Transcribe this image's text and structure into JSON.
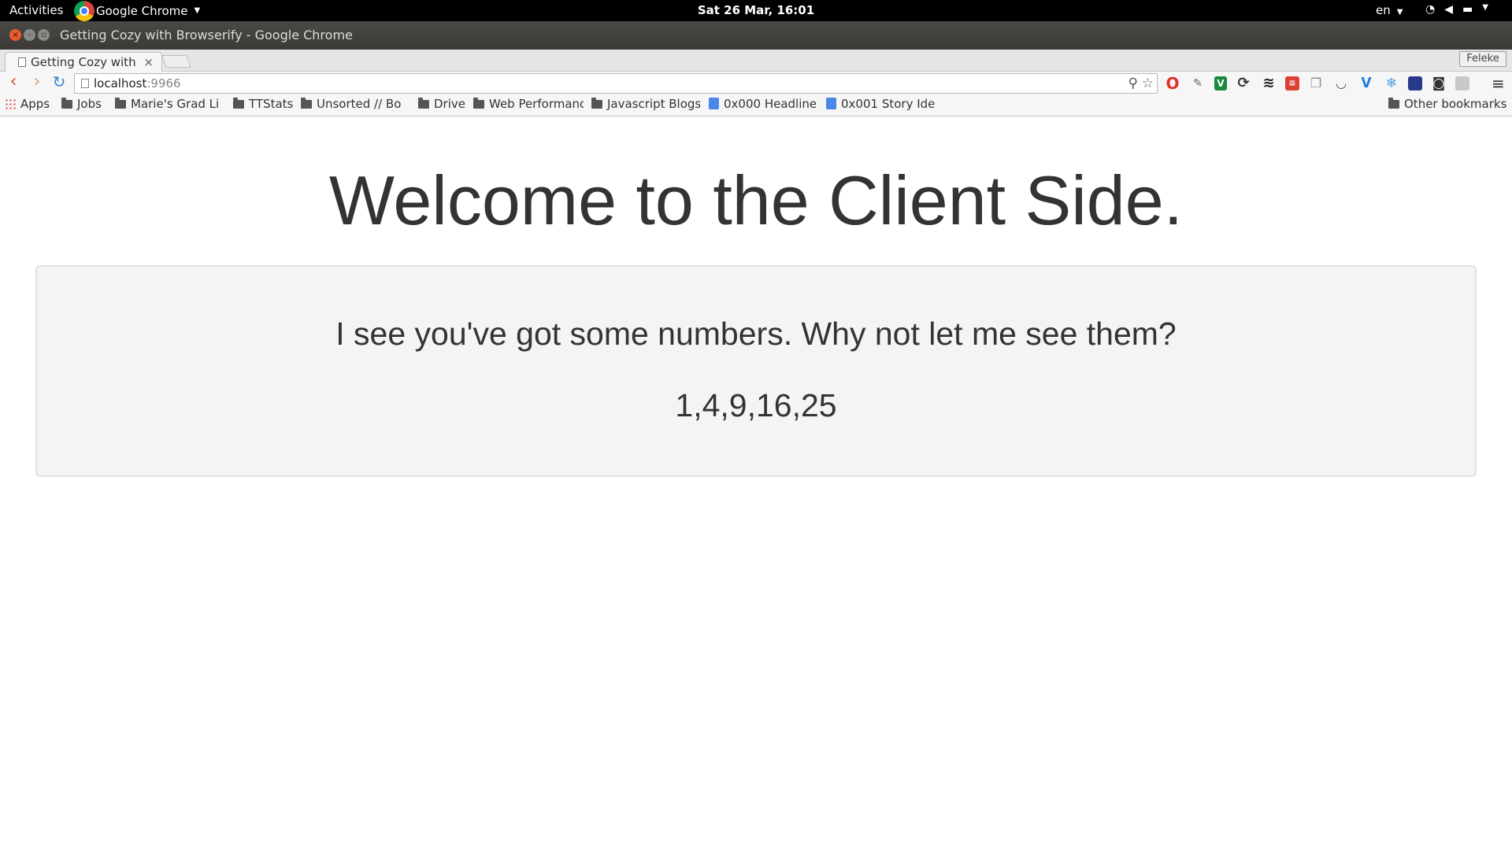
{
  "topbar": {
    "activities": "Activities",
    "app_name": "Google Chrome",
    "clock": "Sat 26 Mar, 16:01",
    "language": "en"
  },
  "window": {
    "title": "Getting Cozy with Browserify - Google Chrome"
  },
  "tabs": [
    {
      "label": "Getting Cozy with"
    }
  ],
  "profile": "Feleke",
  "omnibox": {
    "host": "localhost",
    "port": ":9966"
  },
  "extensions": [
    "opera-icon",
    "eyedropper-icon",
    "v-icon",
    "sync-icon",
    "buffer-icon",
    "todoist-icon",
    "copy-icon",
    "pocket-icon",
    "vimeo-icon",
    "snowflake-icon",
    "bookmark-icon",
    "camera-icon",
    "grey-square-icon"
  ],
  "bookmarks": {
    "items": [
      {
        "label": "Apps",
        "icon": "apps-icon"
      },
      {
        "label": "Jobs",
        "icon": "folder-icon"
      },
      {
        "label": "Marie's Grad Li",
        "icon": "folder-icon"
      },
      {
        "label": "TTStats",
        "icon": "folder-icon"
      },
      {
        "label": "Unsorted // Bo",
        "icon": "folder-icon"
      },
      {
        "label": "Drive",
        "icon": "folder-icon"
      },
      {
        "label": "Web Performanc",
        "icon": "folder-icon"
      },
      {
        "label": "Javascript Blogs",
        "icon": "folder-icon"
      },
      {
        "label": "0x000 Headline",
        "icon": "doc-icon"
      },
      {
        "label": "0x001 Story Ide",
        "icon": "doc-icon"
      }
    ],
    "other": "Other bookmarks"
  },
  "page": {
    "heading": "Welcome to the Client Side.",
    "prompt": "I see you've got some numbers. Why not let me see them?",
    "numbers": "1,4,9,16,25"
  }
}
